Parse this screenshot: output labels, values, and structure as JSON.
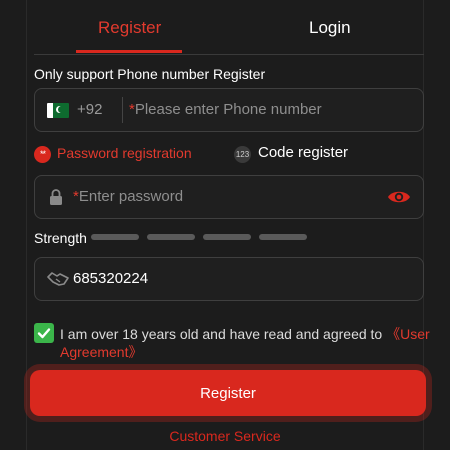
{
  "tabs": [
    {
      "label": "Register",
      "active": true
    },
    {
      "label": "Login",
      "active": false
    }
  ],
  "form": {
    "section_label": "Only support Phone number Register",
    "phone": {
      "country_flag": "pakistan-flag-icon",
      "country_code": "+92",
      "required_mark": "*",
      "placeholder": "Please enter Phone number",
      "value": ""
    },
    "modes": [
      {
        "label": "Password registration",
        "icon": "password-icon",
        "icon_text": "**",
        "selected": true
      },
      {
        "label": "Code register",
        "icon": "code-123-icon",
        "icon_text": "123",
        "selected": false
      }
    ],
    "password": {
      "required_mark": "*",
      "placeholder": "Enter password",
      "value": "",
      "icons": [
        "lock-icon",
        "eye-icon"
      ]
    },
    "strength": {
      "label": "Strength",
      "segments": 4,
      "filled": 0
    },
    "code": {
      "icon": "handshake-icon",
      "value": "685320224"
    },
    "agreement": {
      "checked": true,
      "text": "I am over 18 years old and have read and agreed to ",
      "link": "《User Agreement》"
    },
    "submit_label": "Register",
    "service_link": "Customer Service"
  },
  "colors": {
    "accent": "#d9281e",
    "background": "#1c1c1c",
    "check": "#3bb54a"
  }
}
